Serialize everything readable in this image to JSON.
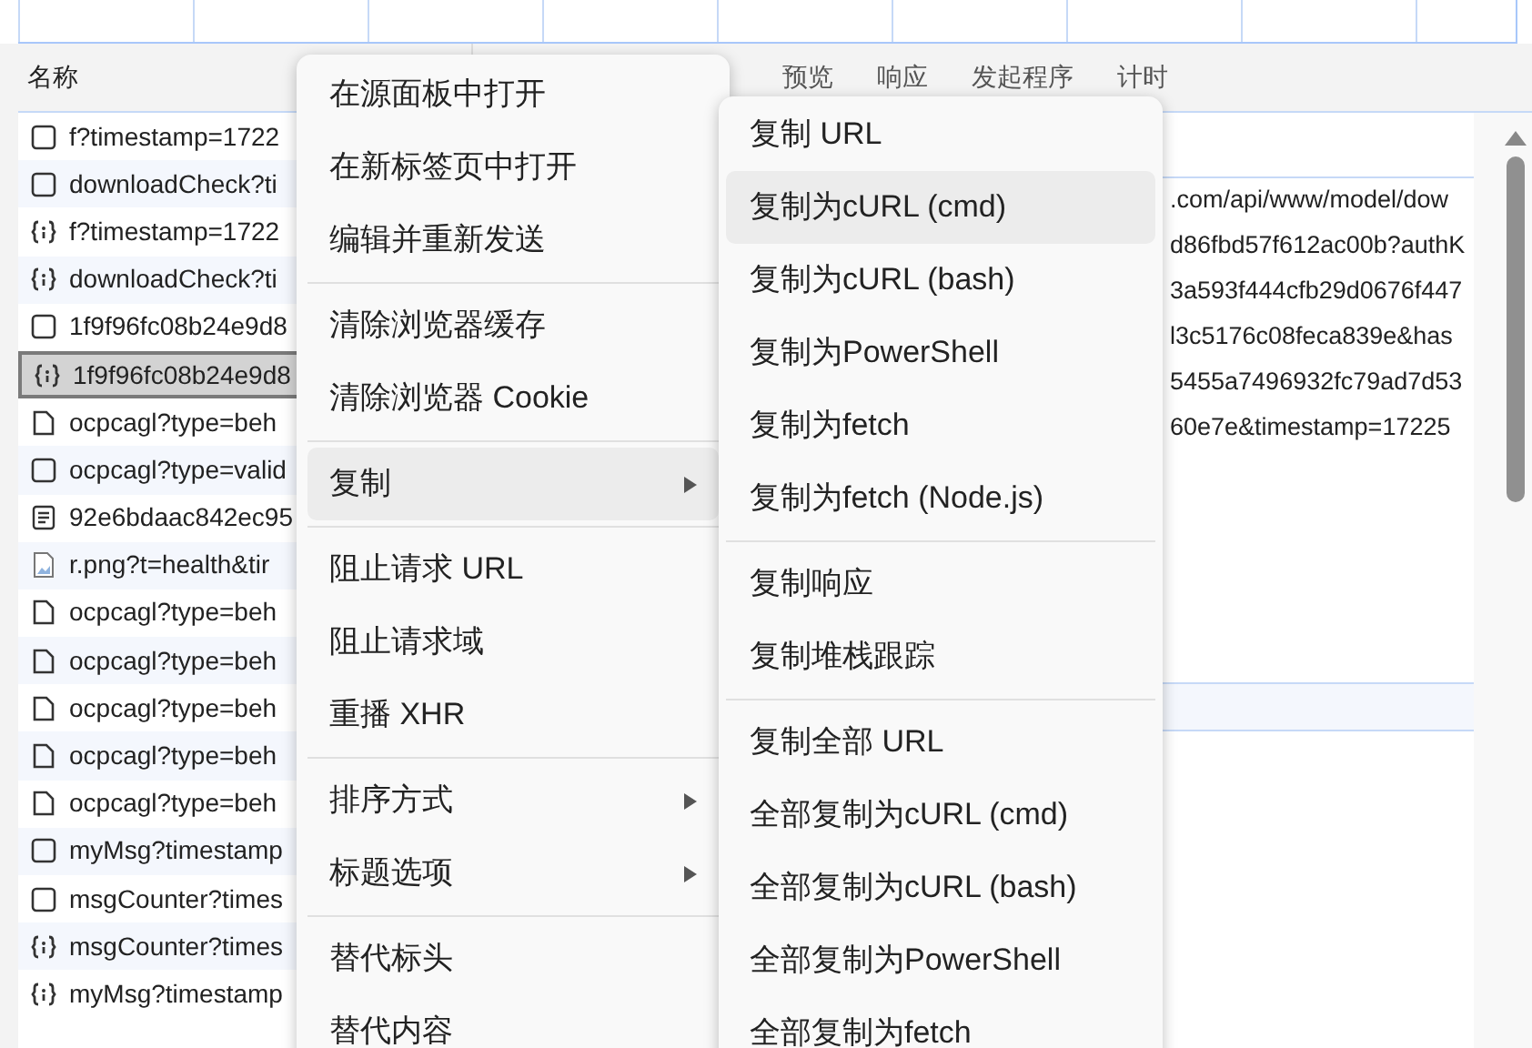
{
  "name_header": "名称",
  "detail_tabs": [
    {
      "label": "预览",
      "selected": false
    },
    {
      "label": "响应",
      "selected": false
    },
    {
      "label": "发起程序",
      "selected": false
    },
    {
      "label": "计时",
      "selected": false
    }
  ],
  "requests": [
    {
      "kind": "blank",
      "name": "f?timestamp=1722",
      "selected": false
    },
    {
      "kind": "blank",
      "name": "downloadCheck?ti",
      "selected": false
    },
    {
      "kind": "xhr",
      "name": "f?timestamp=1722",
      "selected": false
    },
    {
      "kind": "xhr",
      "name": "downloadCheck?ti",
      "selected": false
    },
    {
      "kind": "blank",
      "name": "1f9f96fc08b24e9d8",
      "selected": false
    },
    {
      "kind": "xhr",
      "name": "1f9f96fc08b24e9d8",
      "selected": true
    },
    {
      "kind": "doc",
      "name": "ocpcagl?type=beh",
      "selected": false
    },
    {
      "kind": "blank",
      "name": "ocpcagl?type=valid",
      "selected": false
    },
    {
      "kind": "text",
      "name": "92e6bdaac842ec95",
      "selected": false
    },
    {
      "kind": "image",
      "name": "r.png?t=health&tir",
      "selected": false
    },
    {
      "kind": "doc",
      "name": "ocpcagl?type=beh",
      "selected": false
    },
    {
      "kind": "doc",
      "name": "ocpcagl?type=beh",
      "selected": false
    },
    {
      "kind": "doc",
      "name": "ocpcagl?type=beh",
      "selected": false
    },
    {
      "kind": "doc",
      "name": "ocpcagl?type=beh",
      "selected": false
    },
    {
      "kind": "doc",
      "name": "ocpcagl?type=beh",
      "selected": false
    },
    {
      "kind": "blank",
      "name": "myMsg?timestamp",
      "selected": false
    },
    {
      "kind": "blank",
      "name": "msgCounter?times",
      "selected": false
    },
    {
      "kind": "xhr",
      "name": "msgCounter?times",
      "selected": false
    },
    {
      "kind": "xhr",
      "name": "myMsg?timestamp",
      "selected": false
    }
  ],
  "url_lines": [
    ".com/api/www/model/dow",
    "d86fbd57f612ac00b?authK",
    "3a593f444cfb29d0676f447",
    "l3c5176c08feca839e&has",
    "5455a7496932fc79ad7d53",
    "60e7e&timestamp=17225"
  ],
  "context_menu": {
    "groups": [
      [
        {
          "label": "在源面板中打开",
          "submenu": false,
          "expanded": false
        },
        {
          "label": "在新标签页中打开",
          "submenu": false,
          "expanded": false
        },
        {
          "label": "编辑并重新发送",
          "submenu": false,
          "expanded": false
        }
      ],
      [
        {
          "label": "清除浏览器缓存",
          "submenu": false,
          "expanded": false
        },
        {
          "label": "清除浏览器 Cookie",
          "submenu": false,
          "expanded": false
        }
      ],
      [
        {
          "label": "复制",
          "submenu": true,
          "expanded": true
        }
      ],
      [
        {
          "label": "阻止请求 URL",
          "submenu": false,
          "expanded": false
        },
        {
          "label": "阻止请求域",
          "submenu": false,
          "expanded": false
        },
        {
          "label": "重播 XHR",
          "submenu": false,
          "expanded": false
        }
      ],
      [
        {
          "label": "排序方式",
          "submenu": true,
          "expanded": false
        },
        {
          "label": "标题选项",
          "submenu": true,
          "expanded": false
        }
      ],
      [
        {
          "label": "替代标头",
          "submenu": false,
          "expanded": false
        },
        {
          "label": "替代内容",
          "submenu": false,
          "expanded": false
        }
      ]
    ]
  },
  "copy_submenu": {
    "groups": [
      [
        {
          "label": "复制 URL",
          "selected": false
        },
        {
          "label": "复制为cURL (cmd)",
          "selected": true
        },
        {
          "label": "复制为cURL (bash)",
          "selected": false
        },
        {
          "label": "复制为PowerShell",
          "selected": false
        },
        {
          "label": "复制为fetch",
          "selected": false
        },
        {
          "label": "复制为fetch (Node.js)",
          "selected": false
        }
      ],
      [
        {
          "label": "复制响应",
          "selected": false
        },
        {
          "label": "复制堆栈跟踪",
          "selected": false
        }
      ],
      [
        {
          "label": "复制全部 URL",
          "selected": false
        },
        {
          "label": "全部复制为cURL (cmd)",
          "selected": false
        },
        {
          "label": "全部复制为cURL (bash)",
          "selected": false
        },
        {
          "label": "全部复制为PowerShell",
          "selected": false
        },
        {
          "label": "全部复制为fetch",
          "selected": false
        }
      ]
    ]
  }
}
